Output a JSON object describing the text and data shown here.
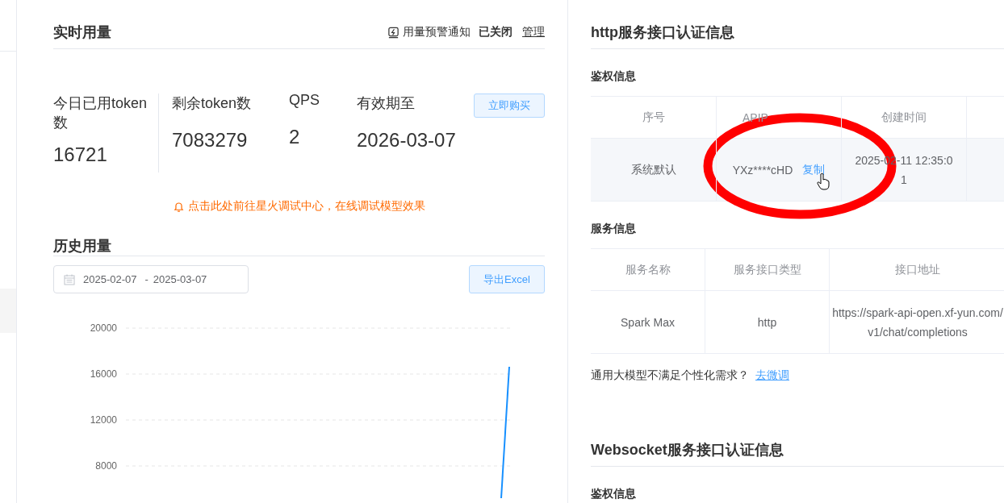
{
  "realtime": {
    "title": "实时用量",
    "alert": {
      "label": "用量预警通知",
      "status": "已关闭",
      "link": "管理"
    },
    "stats": [
      {
        "label": "今日已用token数",
        "value": "16721"
      },
      {
        "label": "剩余token数",
        "value": "7083279"
      },
      {
        "label": "QPS",
        "value": "2"
      },
      {
        "label": "有效期至",
        "value": "2026-03-07"
      }
    ],
    "buy_button": "立即购买",
    "notice": "点击此处前往星火调试中心，在线调试模型效果"
  },
  "history": {
    "title": "历史用量",
    "date_range": {
      "start": "2025-02-07",
      "separator": "-",
      "end": "2025-03-07"
    },
    "export_button": "导出Excel",
    "chart": {
      "y_labels": [
        "20000",
        "16000",
        "12000",
        "8000"
      ]
    }
  },
  "http": {
    "title": "http服务接口认证信息",
    "auth": {
      "title": "鉴权信息",
      "columns": [
        "序号",
        "APIP",
        "创建时间"
      ],
      "rows": [
        {
          "name": "系统默认",
          "key": "YXz****cHD",
          "copy": "复制",
          "created": "2025-02-11 12:35:01"
        }
      ]
    },
    "service": {
      "title": "服务信息",
      "columns": [
        "服务名称",
        "服务接口类型",
        "接口地址"
      ],
      "rows": [
        {
          "name": "Spark Max",
          "type": "http",
          "url": "https://spark-api-open.xf-yun.com/v1/chat/completions"
        }
      ]
    },
    "finetune": {
      "text": "通用大模型不满足个性化需求？",
      "link": "去微调"
    }
  },
  "websocket": {
    "title": "Websocket服务接口认证信息",
    "auth": {
      "title": "鉴权信息"
    }
  }
}
